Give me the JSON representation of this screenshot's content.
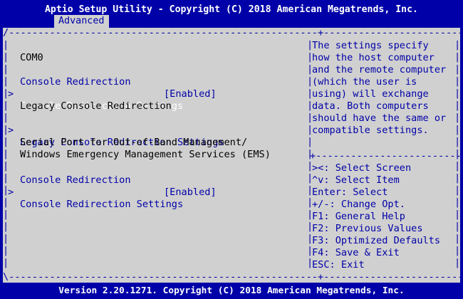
{
  "header": {
    "title": "Aptio Setup Utility - Copyright (C) 2018 American Megatrends, Inc.",
    "active_tab": "Advanced"
  },
  "main": {
    "com0": {
      "heading": "COM0",
      "console_redirection_label": "Console Redirection",
      "console_redirection_value": "[Enabled]",
      "settings_label": "Console Redirection Settings"
    },
    "legacy": {
      "heading": "Legacy Console Redirection",
      "settings_label": "Legacy Console Redirection Settings"
    },
    "serial": {
      "heading_line1": "Serial Port for Out-of-Band Management/",
      "heading_line2": "Windows Emergency Management Services (EMS)",
      "console_redirection_label": "Console Redirection",
      "console_redirection_value": "[Enabled]",
      "settings_label": "Console Redirection Settings"
    }
  },
  "help": {
    "lines": [
      "The settings specify",
      "how the host computer",
      "and the remote computer",
      "(which the user is",
      "using) will exchange",
      "data. Both computers",
      "should have the same or",
      "compatible settings."
    ]
  },
  "keys": {
    "lines": [
      "><: Select Screen",
      "^v: Select Item",
      "Enter: Select",
      "+/-: Change Opt.",
      "F1: General Help",
      "F2: Previous Values",
      "F3: Optimized Defaults",
      "F4: Save & Exit",
      "ESC: Exit"
    ]
  },
  "footer": {
    "text": "Version 2.20.1271. Copyright (C) 2018 American Megatrends, Inc."
  },
  "colors": {
    "background": "#0000a8",
    "panel": "#d0d0d0",
    "highlight_text": "#ffffff",
    "item_text": "#0000a8",
    "heading_text": "#000000"
  }
}
